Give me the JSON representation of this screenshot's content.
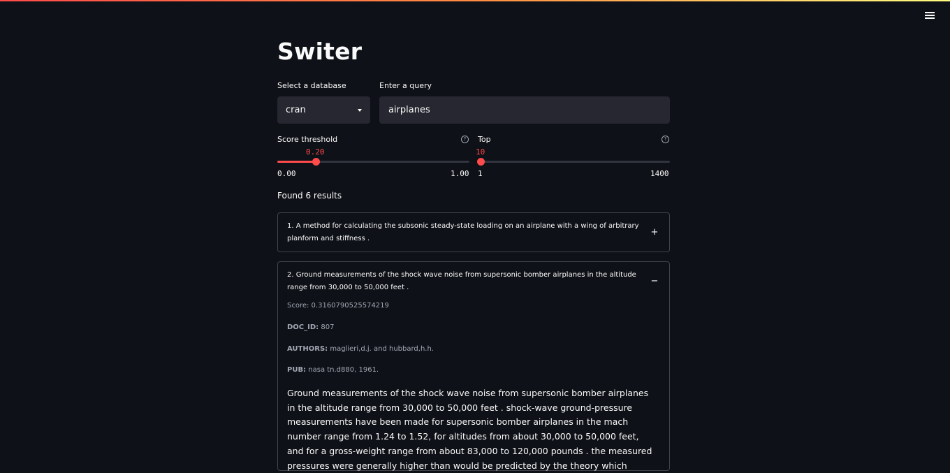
{
  "app": {
    "title": "Switer",
    "menu_icon": "hamburger-icon"
  },
  "database": {
    "label": "Select a database",
    "selected": "cran"
  },
  "query": {
    "label": "Enter a query",
    "value": "airplanes"
  },
  "score_threshold": {
    "label": "Score threshold",
    "value": "0.20",
    "min": "0.00",
    "max": "1.00",
    "fraction": 0.2
  },
  "top": {
    "label": "Top",
    "value": "10",
    "min": "1",
    "max": "1400",
    "fraction": 0.0064
  },
  "results": {
    "summary": "Found 6 results",
    "items": [
      {
        "title": "1. A method for calculating the subsonic steady-state loading on an airplane with a wing of arbitrary planform and stiffness .",
        "toggle": "+"
      },
      {
        "title": "2. Ground measurements of the shock wave noise from supersonic bomber airplanes in the altitude range from 30,000 to 50,000 feet .",
        "toggle": "−",
        "score": "Score: 0.3160790525574219",
        "doc_id_label": "DOC_ID:",
        "doc_id": "807",
        "authors_label": "AUTHORS:",
        "authors": "maglieri,d.j. and hubbard,h.h.",
        "pub_label": "PUB:",
        "pub": "nasa tn.d880, 1961.",
        "abstract": "Ground measurements of the shock wave noise from supersonic bomber airplanes in the altitude range from 30,000 to 50,000 feet . shock-wave ground-pressure measurements have been made for supersonic bomber airplanes in the mach number range from 1.24 to 1.52, for altitudes from about 30,000 to 50,000 feet, and for a gross-weight range from about 83,000 to 120,000 pounds . the measured pressures were generally higher than would be predicted by the theory which"
      }
    ]
  },
  "colors": {
    "background": "#0e1117",
    "accent": "#ff4b4b",
    "input_bg": "#262730"
  }
}
